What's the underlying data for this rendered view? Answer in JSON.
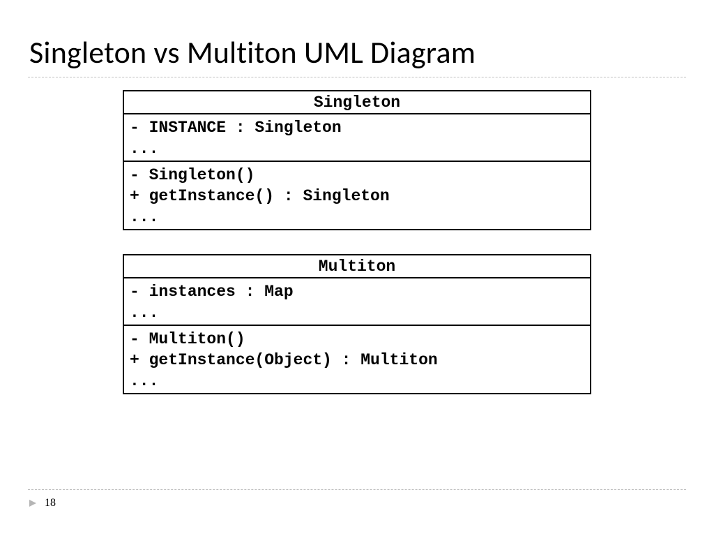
{
  "slide": {
    "title": "Singleton vs Multiton UML Diagram",
    "page_number": "18"
  },
  "classes": [
    {
      "name": "Singleton",
      "attributes": [
        "- INSTANCE : Singleton",
        "..."
      ],
      "methods": [
        "- Singleton()",
        "+ getInstance() : Singleton",
        "..."
      ]
    },
    {
      "name": "Multiton",
      "attributes": [
        "- instances : Map",
        "..."
      ],
      "methods": [
        "- Multiton()",
        "+ getInstance(Object) : Multiton",
        "..."
      ]
    }
  ]
}
